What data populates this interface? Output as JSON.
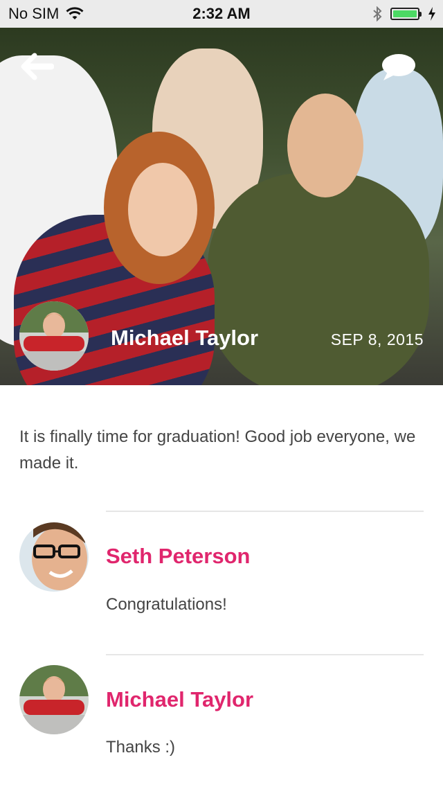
{
  "status_bar": {
    "carrier": "No SIM",
    "time": "2:32 AM",
    "battery_level": 1.0,
    "battery_color": "#4cd964"
  },
  "post": {
    "author": "Michael Taylor",
    "date": "SEP 8, 2015",
    "text": "It is finally time for graduation! Good job everyone, we made it."
  },
  "comments": [
    {
      "author": "Seth Peterson",
      "text": "Congratulations!"
    },
    {
      "author": "Michael Taylor",
      "text": "Thanks :)"
    }
  ],
  "colors": {
    "accent": "#e0266d",
    "body_text": "#444444",
    "divider": "#e6e6e6"
  },
  "icons": [
    "back-arrow-icon",
    "chat-bubble-icon",
    "wifi-icon",
    "bluetooth-icon",
    "battery-icon",
    "charging-icon"
  ]
}
